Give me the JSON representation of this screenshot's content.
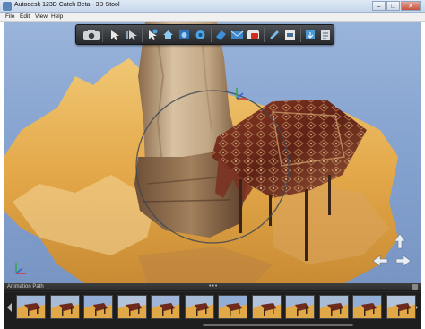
{
  "window": {
    "title": "Autodesk 123D Catch Beta - 3D Stool",
    "minimize_glyph": "–",
    "maximize_glyph": "□",
    "close_glyph": "✕"
  },
  "menu": {
    "items": [
      {
        "label": "File"
      },
      {
        "label": "Edit"
      },
      {
        "label": "View"
      },
      {
        "label": "Help"
      }
    ]
  },
  "toolbar": {
    "icons": [
      "camera-icon",
      "orbit-icon",
      "pan-icon",
      "select-icon",
      "home-view-icon",
      "animation-icon",
      "video-icon",
      "eraser-icon",
      "email-icon",
      "youtube-icon",
      "pen-icon",
      "export-icon",
      "download-icon",
      "share-icon"
    ]
  },
  "anim_panel": {
    "title": "Animation Path",
    "grip": "•••",
    "frame_count": 12
  },
  "colors": {
    "sky": "#8aa7d2",
    "sand": "#e0a847",
    "pillar": "#c9ae8c",
    "rug": "#6e2a1c",
    "toolbar": "#333538"
  }
}
